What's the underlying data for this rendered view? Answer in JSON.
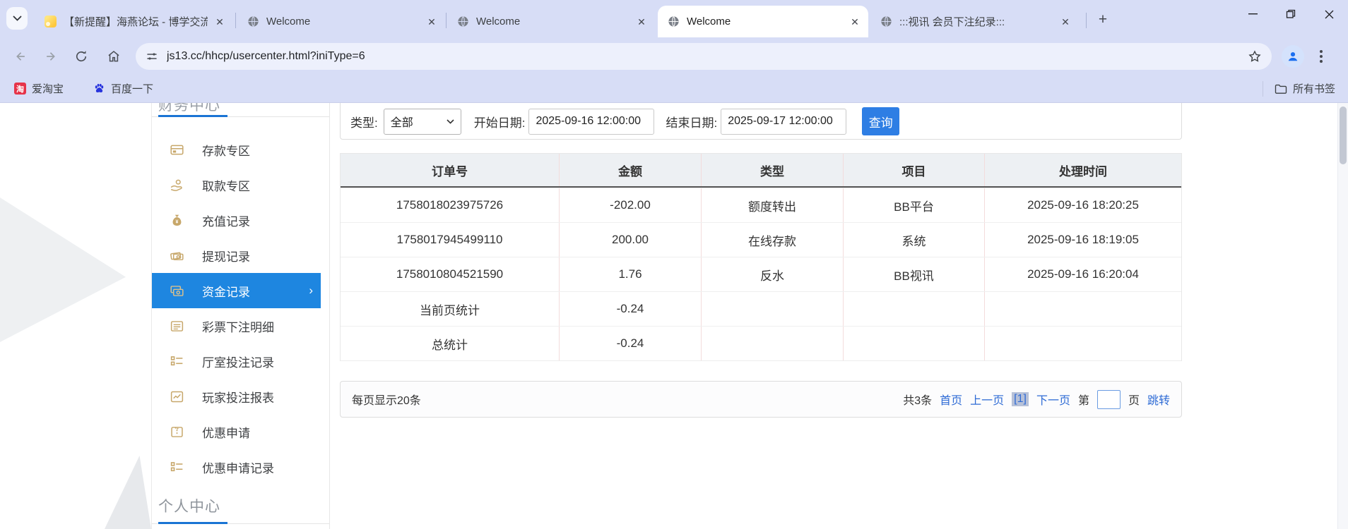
{
  "browser": {
    "tabs": [
      {
        "title": "【新提醒】海燕论坛 - 博学交流",
        "favicon": "forum",
        "active": false
      },
      {
        "title": "Welcome",
        "favicon": "globe",
        "active": false
      },
      {
        "title": "Welcome",
        "favicon": "globe",
        "active": false
      },
      {
        "title": "Welcome",
        "favicon": "globe",
        "active": true
      },
      {
        "title": ":::视讯 会员下注纪录:::",
        "favicon": "globe",
        "active": false
      }
    ],
    "url": "js13.cc/hhcp/usercenter.html?iniType=6",
    "bookmarks": [
      {
        "label": "爱淘宝",
        "icon": "taobao"
      },
      {
        "label": "百度一下",
        "icon": "baidu-paw"
      }
    ],
    "all_bookmarks_label": "所有书签"
  },
  "sidebar": {
    "top_heading": "财务中心",
    "items": [
      {
        "label": "存款专区",
        "icon": "deposit",
        "active": false
      },
      {
        "label": "取款专区",
        "icon": "withdraw",
        "active": false
      },
      {
        "label": "充值记录",
        "icon": "recharge",
        "active": false
      },
      {
        "label": "提现记录",
        "icon": "cashout",
        "active": false
      },
      {
        "label": "资金记录",
        "icon": "funds",
        "active": true
      },
      {
        "label": "彩票下注明细",
        "icon": "lottery-detail",
        "active": false
      },
      {
        "label": "厅室投注记录",
        "icon": "hall-bets",
        "active": false
      },
      {
        "label": "玩家投注报表",
        "icon": "player-report",
        "active": false
      },
      {
        "label": "优惠申请",
        "icon": "promo-apply",
        "active": false
      },
      {
        "label": "优惠申请记录",
        "icon": "promo-records",
        "active": false
      }
    ],
    "bottom_heading": "个人中心"
  },
  "filters": {
    "type_label": "类型:",
    "type_value": "全部",
    "start_label": "开始日期:",
    "start_value": "2025-09-16 12:00:00",
    "end_label": "结束日期:",
    "end_value": "2025-09-17 12:00:00",
    "query_button": "查询"
  },
  "table": {
    "headers": [
      "订单号",
      "金额",
      "类型",
      "项目",
      "处理时间"
    ],
    "rows": [
      [
        "1758018023975726",
        "-202.00",
        "额度转出",
        "BB平台",
        "2025-09-16 18:20:25"
      ],
      [
        "1758017945499110",
        "200.00",
        "在线存款",
        "系统",
        "2025-09-16 18:19:05"
      ],
      [
        "1758010804521590",
        "1.76",
        "反水",
        "BB视讯",
        "2025-09-16 16:20:04"
      ],
      [
        "当前页统计",
        "-0.24",
        "",
        "",
        ""
      ],
      [
        "总统计",
        "-0.24",
        "",
        "",
        ""
      ]
    ]
  },
  "pagination": {
    "per_page": "每页显示20条",
    "total": "共3条",
    "first": "首页",
    "prev": "上一页",
    "current": "[1]",
    "next": "下一页",
    "page_label_before": "第",
    "page_label_after": "页",
    "jump": "跳转"
  },
  "colors": {
    "chrome_bg": "#d7ddf6",
    "active_menu_bg": "#1e86e0",
    "accent_blue": "#2e7ee4",
    "link_blue": "#2e6bd5",
    "gold_icon": "#c7a76a",
    "table_header_bg": "#edf0f3"
  }
}
